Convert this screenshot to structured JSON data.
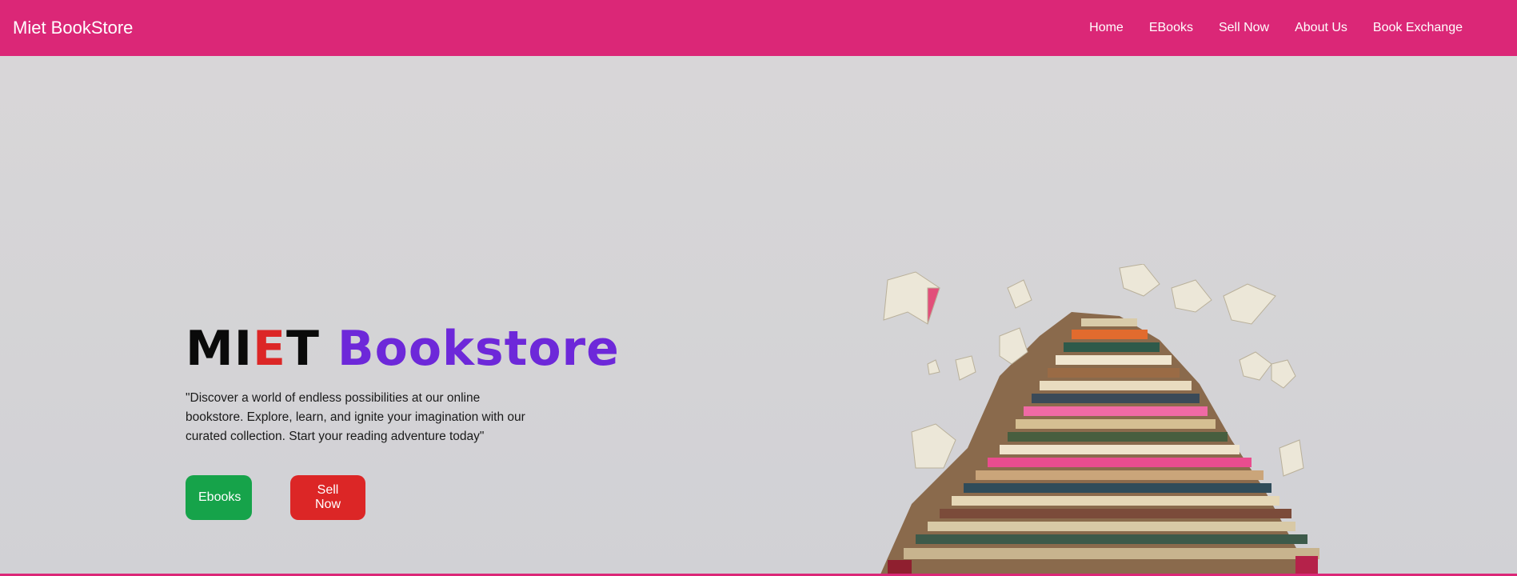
{
  "navbar": {
    "brand": "Miet BookStore",
    "links": [
      {
        "label": "Home"
      },
      {
        "label": "EBooks"
      },
      {
        "label": "Sell Now"
      },
      {
        "label": "About Us"
      },
      {
        "label": "Book Exchange"
      }
    ],
    "color": "#db2777"
  },
  "hero": {
    "title_parts": {
      "mi": "MI",
      "e": "E",
      "t": "T",
      "bookstore": "Bookstore"
    },
    "description": "\"Discover a world of endless possibilities at our online bookstore. Explore, learn, and ignite your imagination with our curated collection. Start your reading adventure today\"",
    "buttons": {
      "ebooks": "Ebooks",
      "sell_now": "Sell Now"
    },
    "colors": {
      "title_black": "#0a0a0a",
      "title_red": "#dc2626",
      "title_purple": "#6d28d9",
      "ebooks_button": "#16a34a",
      "sell_button": "#dc2626"
    },
    "image": "stack-of-books-illustration"
  }
}
